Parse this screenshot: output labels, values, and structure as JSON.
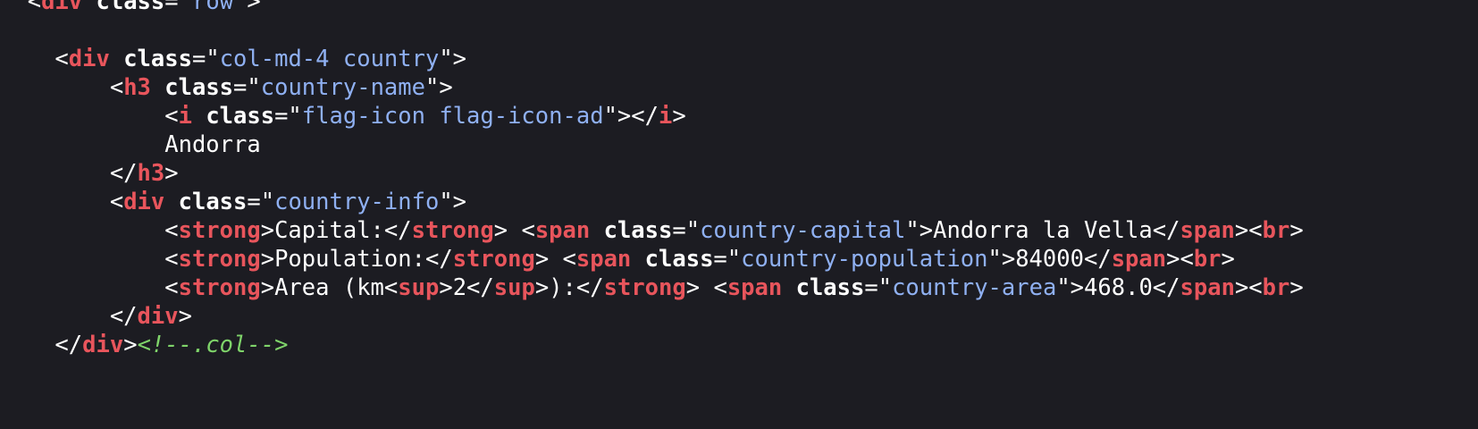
{
  "colors": {
    "background": "#1c1c22",
    "tag": "#e8555c",
    "attribute": "#ffffff",
    "string": "#8fb0f2",
    "text": "#ffffff",
    "comment": "#7fd46a"
  },
  "code_lines": [
    {
      "indent": "  ",
      "tokens": [
        {
          "t": "punct",
          "v": "<"
        },
        {
          "t": "tag",
          "v": "div"
        },
        {
          "t": "punct",
          "v": " "
        },
        {
          "t": "attr",
          "v": "class"
        },
        {
          "t": "punct",
          "v": "=\""
        },
        {
          "t": "str",
          "v": "row"
        },
        {
          "t": "punct",
          "v": "\">"
        }
      ]
    },
    {
      "indent": "",
      "tokens": []
    },
    {
      "indent": "    ",
      "tokens": [
        {
          "t": "punct",
          "v": "<"
        },
        {
          "t": "tag",
          "v": "div"
        },
        {
          "t": "punct",
          "v": " "
        },
        {
          "t": "attr",
          "v": "class"
        },
        {
          "t": "punct",
          "v": "=\""
        },
        {
          "t": "str",
          "v": "col-md-4 country"
        },
        {
          "t": "punct",
          "v": "\">"
        }
      ]
    },
    {
      "indent": "        ",
      "tokens": [
        {
          "t": "punct",
          "v": "<"
        },
        {
          "t": "tag",
          "v": "h3"
        },
        {
          "t": "punct",
          "v": " "
        },
        {
          "t": "attr",
          "v": "class"
        },
        {
          "t": "punct",
          "v": "=\""
        },
        {
          "t": "str",
          "v": "country-name"
        },
        {
          "t": "punct",
          "v": "\">"
        }
      ]
    },
    {
      "indent": "            ",
      "tokens": [
        {
          "t": "punct",
          "v": "<"
        },
        {
          "t": "tag",
          "v": "i"
        },
        {
          "t": "punct",
          "v": " "
        },
        {
          "t": "attr",
          "v": "class"
        },
        {
          "t": "punct",
          "v": "=\""
        },
        {
          "t": "str",
          "v": "flag-icon flag-icon-ad"
        },
        {
          "t": "punct",
          "v": "\"></"
        },
        {
          "t": "tag",
          "v": "i"
        },
        {
          "t": "punct",
          "v": ">"
        }
      ]
    },
    {
      "indent": "            ",
      "tokens": [
        {
          "t": "text",
          "v": "Andorra"
        }
      ]
    },
    {
      "indent": "        ",
      "tokens": [
        {
          "t": "punct",
          "v": "</"
        },
        {
          "t": "tag",
          "v": "h3"
        },
        {
          "t": "punct",
          "v": ">"
        }
      ]
    },
    {
      "indent": "        ",
      "tokens": [
        {
          "t": "punct",
          "v": "<"
        },
        {
          "t": "tag",
          "v": "div"
        },
        {
          "t": "punct",
          "v": " "
        },
        {
          "t": "attr",
          "v": "class"
        },
        {
          "t": "punct",
          "v": "=\""
        },
        {
          "t": "str",
          "v": "country-info"
        },
        {
          "t": "punct",
          "v": "\">"
        }
      ]
    },
    {
      "indent": "            ",
      "tokens": [
        {
          "t": "punct",
          "v": "<"
        },
        {
          "t": "tag",
          "v": "strong"
        },
        {
          "t": "punct",
          "v": ">"
        },
        {
          "t": "text",
          "v": "Capital:"
        },
        {
          "t": "punct",
          "v": "</"
        },
        {
          "t": "tag",
          "v": "strong"
        },
        {
          "t": "punct",
          "v": "> <"
        },
        {
          "t": "tag",
          "v": "span"
        },
        {
          "t": "punct",
          "v": " "
        },
        {
          "t": "attr",
          "v": "class"
        },
        {
          "t": "punct",
          "v": "=\""
        },
        {
          "t": "str",
          "v": "country-capital"
        },
        {
          "t": "punct",
          "v": "\">"
        },
        {
          "t": "text",
          "v": "Andorra la Vella"
        },
        {
          "t": "punct",
          "v": "</"
        },
        {
          "t": "tag",
          "v": "span"
        },
        {
          "t": "punct",
          "v": "><"
        },
        {
          "t": "tag",
          "v": "br"
        },
        {
          "t": "punct",
          "v": ">"
        }
      ]
    },
    {
      "indent": "            ",
      "tokens": [
        {
          "t": "punct",
          "v": "<"
        },
        {
          "t": "tag",
          "v": "strong"
        },
        {
          "t": "punct",
          "v": ">"
        },
        {
          "t": "text",
          "v": "Population:"
        },
        {
          "t": "punct",
          "v": "</"
        },
        {
          "t": "tag",
          "v": "strong"
        },
        {
          "t": "punct",
          "v": "> <"
        },
        {
          "t": "tag",
          "v": "span"
        },
        {
          "t": "punct",
          "v": " "
        },
        {
          "t": "attr",
          "v": "class"
        },
        {
          "t": "punct",
          "v": "=\""
        },
        {
          "t": "str",
          "v": "country-population"
        },
        {
          "t": "punct",
          "v": "\">"
        },
        {
          "t": "text",
          "v": "84000"
        },
        {
          "t": "punct",
          "v": "</"
        },
        {
          "t": "tag",
          "v": "span"
        },
        {
          "t": "punct",
          "v": "><"
        },
        {
          "t": "tag",
          "v": "br"
        },
        {
          "t": "punct",
          "v": ">"
        }
      ]
    },
    {
      "indent": "            ",
      "tokens": [
        {
          "t": "punct",
          "v": "<"
        },
        {
          "t": "tag",
          "v": "strong"
        },
        {
          "t": "punct",
          "v": ">"
        },
        {
          "t": "text",
          "v": "Area (km"
        },
        {
          "t": "punct",
          "v": "<"
        },
        {
          "t": "tag",
          "v": "sup"
        },
        {
          "t": "punct",
          "v": ">"
        },
        {
          "t": "text",
          "v": "2"
        },
        {
          "t": "punct",
          "v": "</"
        },
        {
          "t": "tag",
          "v": "sup"
        },
        {
          "t": "punct",
          "v": ">"
        },
        {
          "t": "text",
          "v": "):"
        },
        {
          "t": "punct",
          "v": "</"
        },
        {
          "t": "tag",
          "v": "strong"
        },
        {
          "t": "punct",
          "v": "> <"
        },
        {
          "t": "tag",
          "v": "span"
        },
        {
          "t": "punct",
          "v": " "
        },
        {
          "t": "attr",
          "v": "class"
        },
        {
          "t": "punct",
          "v": "=\""
        },
        {
          "t": "str",
          "v": "country-area"
        },
        {
          "t": "punct",
          "v": "\">"
        },
        {
          "t": "text",
          "v": "468.0"
        },
        {
          "t": "punct",
          "v": "</"
        },
        {
          "t": "tag",
          "v": "span"
        },
        {
          "t": "punct",
          "v": "><"
        },
        {
          "t": "tag",
          "v": "br"
        },
        {
          "t": "punct",
          "v": ">"
        }
      ]
    },
    {
      "indent": "        ",
      "tokens": [
        {
          "t": "punct",
          "v": "</"
        },
        {
          "t": "tag",
          "v": "div"
        },
        {
          "t": "punct",
          "v": ">"
        }
      ]
    },
    {
      "indent": "    ",
      "tokens": [
        {
          "t": "punct",
          "v": "</"
        },
        {
          "t": "tag",
          "v": "div"
        },
        {
          "t": "punct",
          "v": ">"
        },
        {
          "t": "comment",
          "v": "<!--.col-->"
        }
      ]
    }
  ]
}
